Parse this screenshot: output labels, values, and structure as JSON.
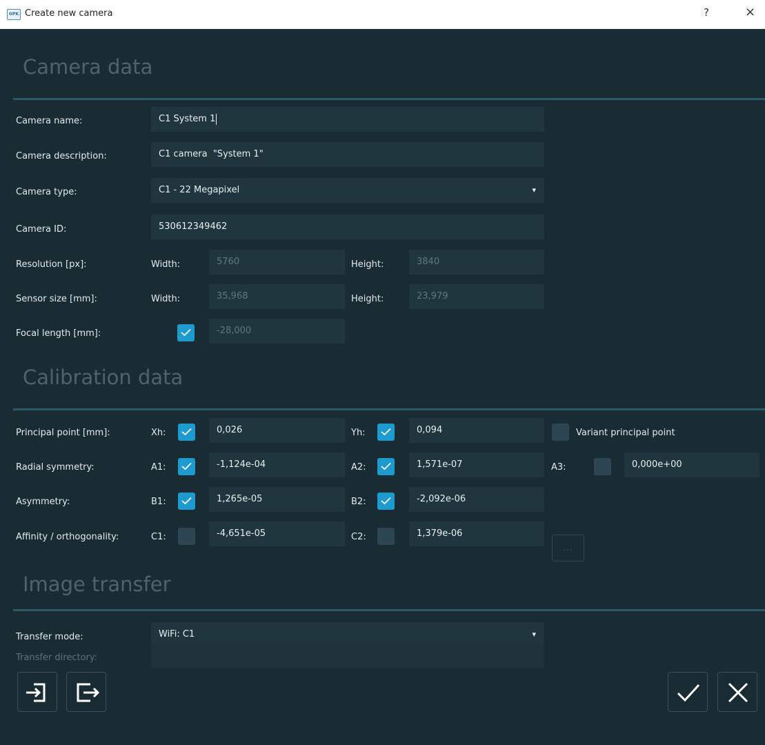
{
  "window": {
    "title": "Create new camera",
    "help": "?",
    "close": "×",
    "app_icon_text": "OPK"
  },
  "sections": {
    "camera": "Camera data",
    "calibration": "Calibration data",
    "transfer": "Image transfer"
  },
  "camera": {
    "name_label": "Camera name:",
    "name_value": "C1 System 1",
    "description_label": "Camera description:",
    "description_value": "C1 camera  \"System 1\"",
    "type_label": "Camera type:",
    "type_value": "C1 - 22 Megapixel",
    "id_label": "Camera ID:",
    "id_value": "530612349462",
    "resolution_label": "Resolution [px]:",
    "res_width_label": "Width:",
    "res_width": "5760",
    "res_height_label": "Height:",
    "res_height": "3840",
    "sensor_label": "Sensor size [mm]:",
    "sensor_width_label": "Width:",
    "sensor_width": "35,968",
    "sensor_height_label": "Height:",
    "sensor_height": "23,979",
    "focal_label": "Focal length [mm]:",
    "focal_value": "-28,000",
    "focal_checked": true
  },
  "calibration": {
    "principal_label": "Principal point [mm]:",
    "xh_label": "Xh:",
    "xh": "0,026",
    "xh_checked": true,
    "yh_label": "Yh:",
    "yh": "0,094",
    "yh_checked": true,
    "variant_label": "Variant principal point",
    "variant_checked": false,
    "radial_label": "Radial symmetry:",
    "a1_label": "A1:",
    "a1": "-1,124e-04",
    "a1_checked": true,
    "a2_label": "A2:",
    "a2": "1,571e-07",
    "a2_checked": true,
    "a3_label": "A3:",
    "a3": "0,000e+00",
    "a3_checked": false,
    "asym_label": "Asymmetry:",
    "b1_label": "B1:",
    "b1": "1,265e-05",
    "b1_checked": true,
    "b2_label": "B2:",
    "b2": "-2,092e-06",
    "b2_checked": true,
    "affinity_label": "Affinity / orthogonality:",
    "c1_label": "C1:",
    "c1": "-4,651e-05",
    "c1_checked": false,
    "c2_label": "C2:",
    "c2": "1,379e-06",
    "c2_checked": false
  },
  "transfer": {
    "mode_label": "Transfer mode:",
    "mode_value": "WiFi: C1",
    "dir_label": "Transfer directory:",
    "dir_value": "",
    "browse": "..."
  },
  "footer": {
    "import_icon": "import-icon",
    "export_icon": "export-icon",
    "ok_icon": "check-icon",
    "cancel_icon": "x-icon"
  },
  "colors": {
    "background": "#1a2c33",
    "field": "#20363e",
    "accent": "#1d9bcf",
    "heading": "#4c646d",
    "rule": "#2c5965"
  }
}
